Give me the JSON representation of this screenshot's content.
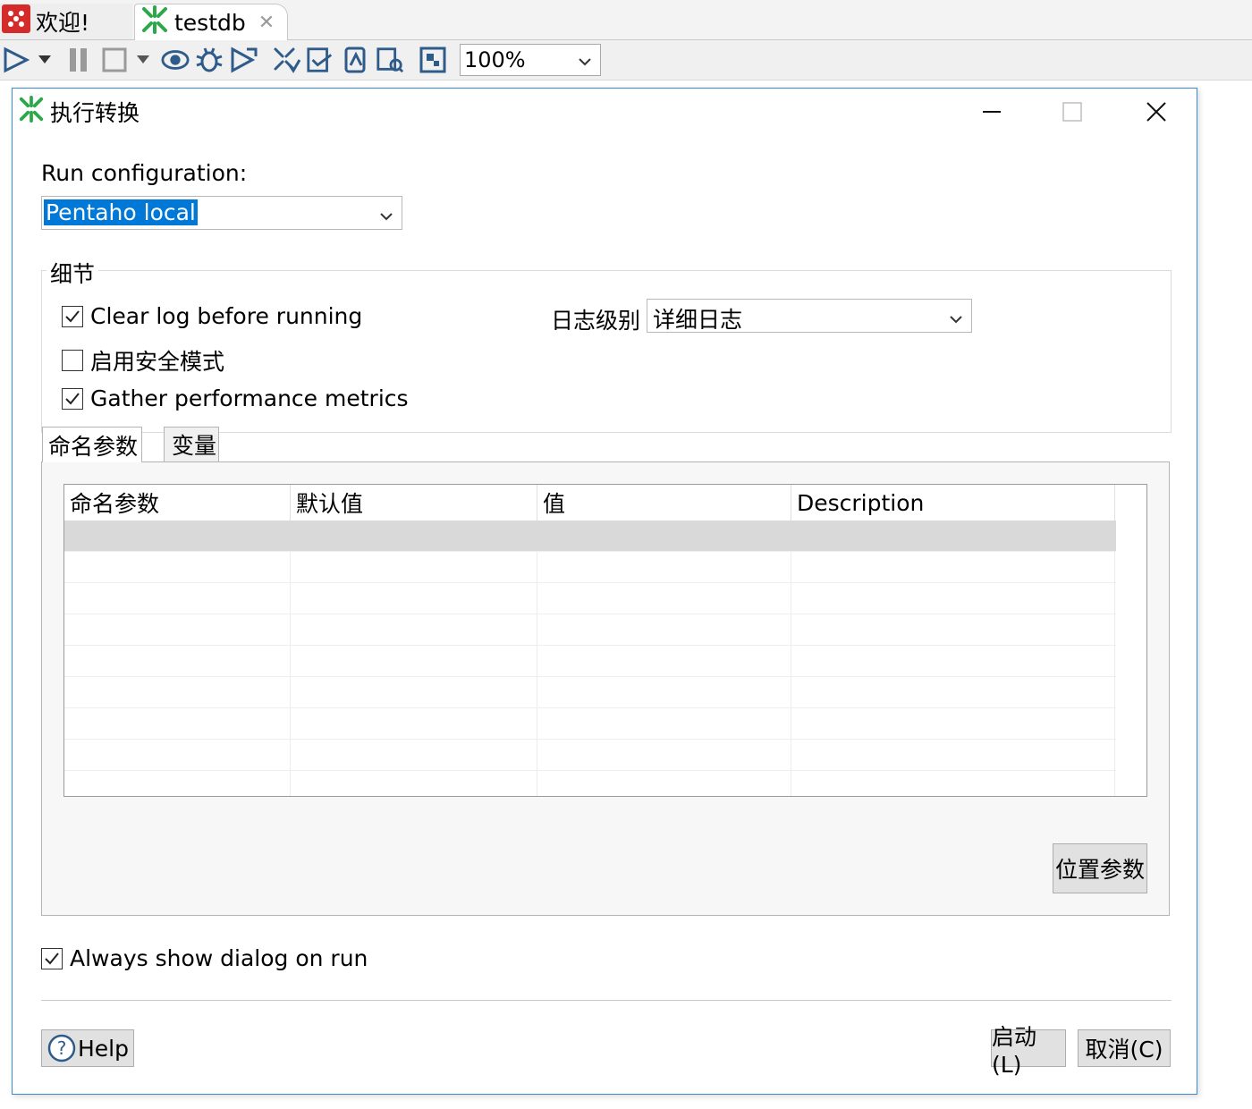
{
  "tabs": [
    {
      "label": "欢迎!"
    },
    {
      "label": "testdb"
    }
  ],
  "toolbar": {
    "zoom_value": "100%"
  },
  "dialog": {
    "title": "执行转换",
    "run_config_label": "Run configuration:",
    "run_config_value": "Pentaho local",
    "details_group_label": "细节",
    "checkboxes": [
      {
        "label": "Clear log before running",
        "checked": true
      },
      {
        "label": "启用安全模式",
        "checked": false
      },
      {
        "label": "Gather performance metrics",
        "checked": true
      }
    ],
    "log_level_label": "日志级别",
    "log_level_value": "详细日志",
    "param_tabs": [
      {
        "label": "命名参数",
        "active": true
      },
      {
        "label": "变量",
        "active": false
      }
    ],
    "table": {
      "columns": [
        "命名参数",
        "默认值",
        "值",
        "Description"
      ],
      "rows": []
    },
    "position_params_button": "位置参数",
    "always_show_label": "Always show dialog on run",
    "always_show_checked": true,
    "help_button": "Help",
    "start_button": "启动(L)",
    "cancel_button": "取消(C)"
  },
  "colors": {
    "accent": "#0078d7",
    "dialog_border": "#3c8bd9",
    "kettle_green": "#2ca84a",
    "welcome_red": "#d42a2a"
  }
}
